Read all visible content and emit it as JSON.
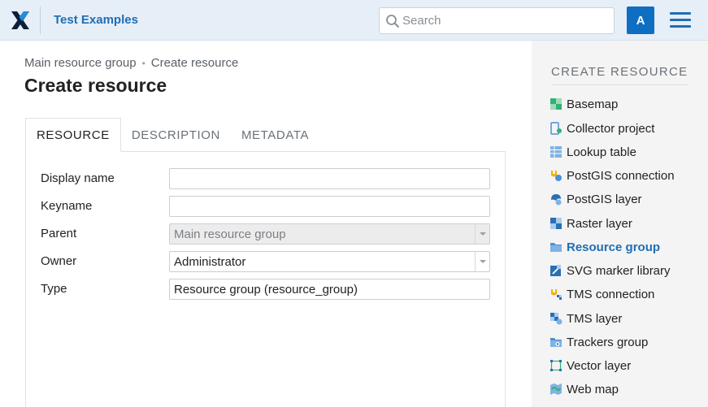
{
  "header": {
    "app_title": "Test Examples",
    "search_placeholder": "Search",
    "avatar_letter": "A"
  },
  "breadcrumb": {
    "parent": "Main resource group",
    "separator": "•",
    "current": "Create resource"
  },
  "page_title": "Create resource",
  "tabs": [
    {
      "label": "RESOURCE",
      "active": true
    },
    {
      "label": "DESCRIPTION",
      "active": false
    },
    {
      "label": "METADATA",
      "active": false
    }
  ],
  "form": {
    "display_name": {
      "label": "Display name",
      "value": ""
    },
    "keyname": {
      "label": "Keyname",
      "value": ""
    },
    "parent": {
      "label": "Parent",
      "value": "Main resource group"
    },
    "owner": {
      "label": "Owner",
      "value": "Administrator"
    },
    "type": {
      "label": "Type",
      "value": "Resource group (resource_group)"
    }
  },
  "sidebar": {
    "title": "CREATE RESOURCE",
    "items": [
      {
        "label": "Basemap",
        "icon": "basemap-icon"
      },
      {
        "label": "Collector project",
        "icon": "collector-project-icon"
      },
      {
        "label": "Lookup table",
        "icon": "lookup-table-icon"
      },
      {
        "label": "PostGIS connection",
        "icon": "postgis-connection-icon"
      },
      {
        "label": "PostGIS layer",
        "icon": "postgis-layer-icon"
      },
      {
        "label": "Raster layer",
        "icon": "raster-layer-icon"
      },
      {
        "label": "Resource group",
        "icon": "resource-group-icon"
      },
      {
        "label": "SVG marker library",
        "icon": "svg-marker-library-icon"
      },
      {
        "label": "TMS connection",
        "icon": "tms-connection-icon"
      },
      {
        "label": "TMS layer",
        "icon": "tms-layer-icon"
      },
      {
        "label": "Trackers group",
        "icon": "trackers-group-icon"
      },
      {
        "label": "Vector layer",
        "icon": "vector-layer-icon"
      },
      {
        "label": "Web map",
        "icon": "web-map-icon"
      }
    ]
  },
  "colors": {
    "accent": "#1f6eb5",
    "header_bg": "#e6eef7",
    "avatar_bg": "#0d6ec2",
    "sidebar_bg": "#f4f4f4"
  }
}
